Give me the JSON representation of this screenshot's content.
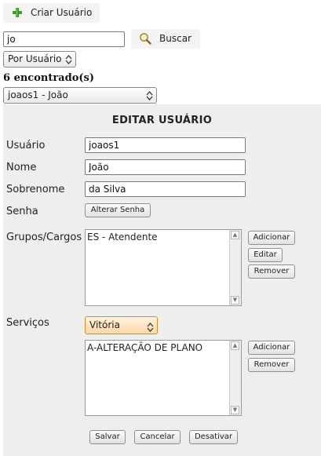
{
  "toolbar": {
    "create_user_label": "Criar Usuário"
  },
  "search": {
    "value": "jo",
    "button_label": "Buscar",
    "filter_selected": "Por Usuário"
  },
  "results": {
    "count_label": "6 encontrado(s)",
    "selected": "joaos1 - João"
  },
  "form": {
    "title": "EDITAR USUÁRIO",
    "username_label": "Usuário",
    "username_value": "joaos1",
    "name_label": "Nome",
    "name_value": "João",
    "surname_label": "Sobrenome",
    "surname_value": "da Silva",
    "password_label": "Senha",
    "change_password_label": "Alterar Senha",
    "groups_label": "Grupos/Cargos",
    "groups": [
      "ES - Atendente"
    ],
    "groups_add_label": "Adicionar",
    "groups_edit_label": "Editar",
    "groups_remove_label": "Remover",
    "services_label": "Serviços",
    "services_unit_selected": "Vitória",
    "services": [
      "A-ALTERAÇÃO DE PLANO"
    ],
    "services_add_label": "Adicionar",
    "services_remove_label": "Remover",
    "save_label": "Salvar",
    "cancel_label": "Cancelar",
    "deactivate_label": "Desativar"
  },
  "colors": {
    "panel_bg": "#eeeeec",
    "plus_icon": "#3e9a2a",
    "accent_select_border": "#d88a2c",
    "accent_select_bg": "#fde3c0"
  }
}
